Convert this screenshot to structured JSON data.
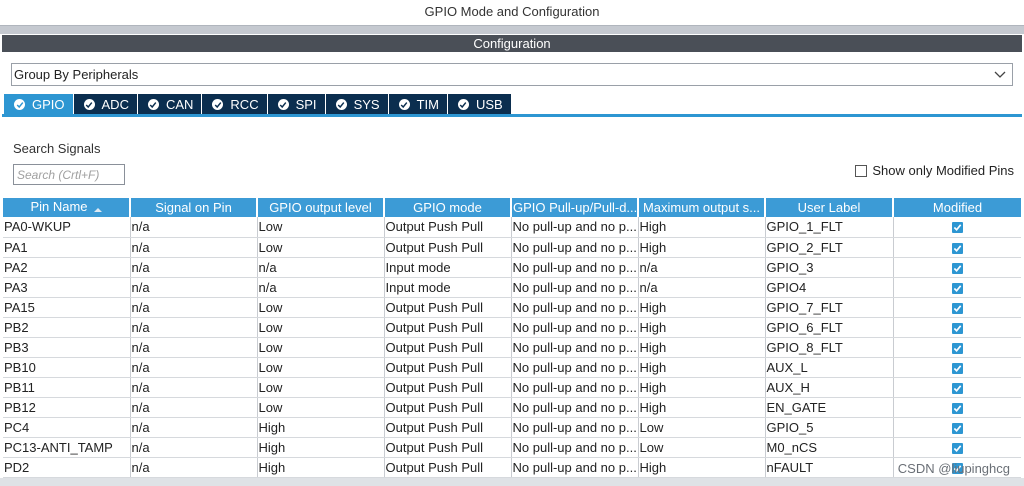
{
  "window": {
    "title": "GPIO Mode and Configuration"
  },
  "config_header": "Configuration",
  "group_select": {
    "value": "Group By Peripherals"
  },
  "tabs": [
    {
      "label": "GPIO",
      "active": true
    },
    {
      "label": "ADC",
      "active": false
    },
    {
      "label": "CAN",
      "active": false
    },
    {
      "label": "RCC",
      "active": false
    },
    {
      "label": "SPI",
      "active": false
    },
    {
      "label": "SYS",
      "active": false
    },
    {
      "label": "TIM",
      "active": false
    },
    {
      "label": "USB",
      "active": false
    }
  ],
  "search": {
    "label": "Search Signals",
    "placeholder": "Search (Crtl+F)"
  },
  "show_modified": {
    "label": "Show only Modified Pins",
    "checked": false
  },
  "table": {
    "columns": [
      "Pin Name",
      "Signal on Pin",
      "GPIO output level",
      "GPIO mode",
      "GPIO Pull-up/Pull-d...",
      "Maximum output s...",
      "User Label",
      "Modified"
    ],
    "rows": [
      [
        "PA0-WKUP",
        "n/a",
        "Low",
        "Output Push Pull",
        "No pull-up and no p...",
        "High",
        "GPIO_1_FLT",
        true
      ],
      [
        "PA1",
        "n/a",
        "Low",
        "Output Push Pull",
        "No pull-up and no p...",
        "High",
        "GPIO_2_FLT",
        true
      ],
      [
        "PA2",
        "n/a",
        "n/a",
        "Input mode",
        "No pull-up and no p...",
        "n/a",
        "GPIO_3",
        true
      ],
      [
        "PA3",
        "n/a",
        "n/a",
        "Input mode",
        "No pull-up and no p...",
        "n/a",
        "GPIO4",
        true
      ],
      [
        "PA15",
        "n/a",
        "Low",
        "Output Push Pull",
        "No pull-up and no p...",
        "High",
        "GPIO_7_FLT",
        true
      ],
      [
        "PB2",
        "n/a",
        "Low",
        "Output Push Pull",
        "No pull-up and no p...",
        "High",
        "GPIO_6_FLT",
        true
      ],
      [
        "PB3",
        "n/a",
        "Low",
        "Output Push Pull",
        "No pull-up and no p...",
        "High",
        "GPIO_8_FLT",
        true
      ],
      [
        "PB10",
        "n/a",
        "Low",
        "Output Push Pull",
        "No pull-up and no p...",
        "High",
        "AUX_L",
        true
      ],
      [
        "PB11",
        "n/a",
        "Low",
        "Output Push Pull",
        "No pull-up and no p...",
        "High",
        "AUX_H",
        true
      ],
      [
        "PB12",
        "n/a",
        "Low",
        "Output Push Pull",
        "No pull-up and no p...",
        "High",
        "EN_GATE",
        true
      ],
      [
        "PC4",
        "n/a",
        "High",
        "Output Push Pull",
        "No pull-up and no p...",
        "Low",
        "GPIO_5",
        true
      ],
      [
        "PC13-ANTI_TAMP",
        "n/a",
        "High",
        "Output Push Pull",
        "No pull-up and no p...",
        "Low",
        "M0_nCS",
        true
      ],
      [
        "PD2",
        "n/a",
        "High",
        "Output Push Pull",
        "No pull-up and no p...",
        "High",
        "nFAULT",
        true
      ]
    ]
  },
  "watermark": "CSDN @liupinghcg",
  "colors": {
    "accent": "#2d96d2",
    "tab_dark": "#0b2e4f",
    "header_bar": "#4a4f57"
  }
}
